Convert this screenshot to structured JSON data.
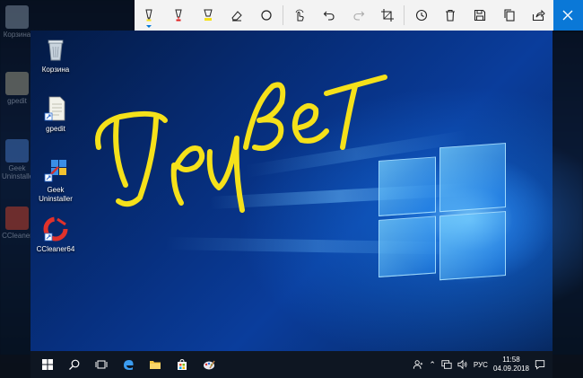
{
  "toolbar": {
    "buttons": [
      "ballpoint-pen",
      "pencil",
      "highlighter",
      "eraser",
      "ruler",
      "touch-writing",
      "undo",
      "redo",
      "crop",
      "history",
      "delete",
      "save",
      "copy",
      "share",
      "close"
    ],
    "colors": {
      "ballpoint": "#f5e11a",
      "pencil": "#e02020",
      "highlighter": "#f5e11a",
      "close_bg": "#0a78d7"
    }
  },
  "background_desktop": {
    "icons": [
      "Корзина",
      "gpedit",
      "Geek Uninstaller",
      "CCleaner"
    ]
  },
  "desktop": {
    "icons": [
      {
        "label": "Корзина",
        "icon": "recycle-bin-icon"
      },
      {
        "label": "gpedit",
        "icon": "document-icon"
      },
      {
        "label": "Geek Uninstaller",
        "icon": "geek-uninstaller-icon"
      },
      {
        "label": "CCleaner64",
        "icon": "ccleaner-icon"
      }
    ]
  },
  "annotation": {
    "text": "Привет",
    "color": "#f5e11a"
  },
  "taskbar": {
    "language": "РУС",
    "time": "11:58",
    "date": "04.09.2018"
  }
}
